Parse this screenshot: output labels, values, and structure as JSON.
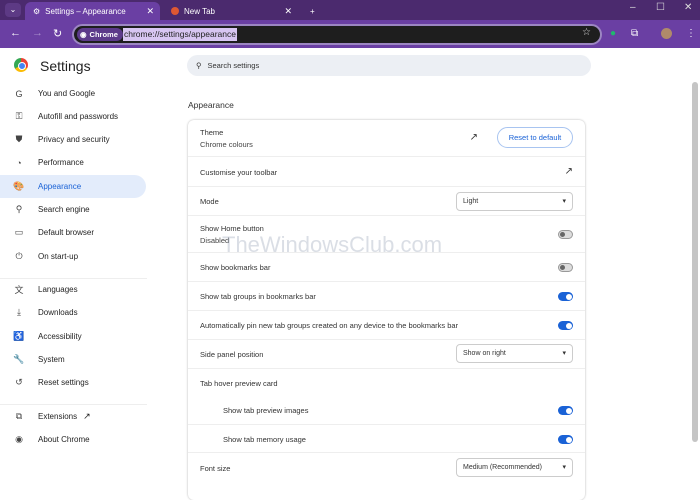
{
  "browser": {
    "tabs": [
      {
        "title": "Settings – Appearance",
        "icon": "gear-icon"
      },
      {
        "title": "New Tab",
        "icon": "duckduckgo-icon"
      }
    ],
    "chip_label": "Chrome",
    "url": "chrome://settings/appearance"
  },
  "sidebar": {
    "title": "Settings",
    "items": [
      {
        "label": "You and Google",
        "icon": "G"
      },
      {
        "label": "Autofill and passwords",
        "icon": "⚿"
      },
      {
        "label": "Privacy and security",
        "icon": "⛊"
      },
      {
        "label": "Performance",
        "icon": "◔"
      },
      {
        "label": "Appearance",
        "icon": "🎨"
      },
      {
        "label": "Search engine",
        "icon": "⚲"
      },
      {
        "label": "Default browser",
        "icon": "▭"
      },
      {
        "label": "On start-up",
        "icon": "⏻"
      },
      {
        "label": "Languages",
        "icon": "文"
      },
      {
        "label": "Downloads",
        "icon": "⤓"
      },
      {
        "label": "Accessibility",
        "icon": "♿"
      },
      {
        "label": "System",
        "icon": "🔧"
      },
      {
        "label": "Reset settings",
        "icon": "↺"
      },
      {
        "label": "Extensions",
        "icon": "⧉"
      },
      {
        "label": "About Chrome",
        "icon": "◉"
      }
    ]
  },
  "search": {
    "placeholder": "Search settings"
  },
  "section_title": "Appearance",
  "appearance": {
    "theme_label": "Theme",
    "theme_value": "Chrome colours",
    "reset_label": "Reset to default",
    "toolbar_label": "Customise your toolbar",
    "mode_label": "Mode",
    "mode_value": "Light",
    "home_label": "Show Home button",
    "home_value": "Disabled",
    "home_on": false,
    "bookmarks_label": "Show bookmarks bar",
    "bookmarks_on": false,
    "tabgroups_label": "Show tab groups in bookmarks bar",
    "tabgroups_on": true,
    "autopin_label": "Automatically pin new tab groups created on any device to the bookmarks bar",
    "autopin_on": true,
    "sidepanel_label": "Side panel position",
    "sidepanel_value": "Show on right",
    "hover_label": "Tab hover preview card",
    "preview_images_label": "Show tab preview images",
    "preview_images_on": true,
    "memory_label": "Show tab memory usage",
    "memory_on": true,
    "fontsize_label": "Font size",
    "fontsize_value": "Medium (Recommended)"
  },
  "watermark": "TheWindowsClub.com"
}
